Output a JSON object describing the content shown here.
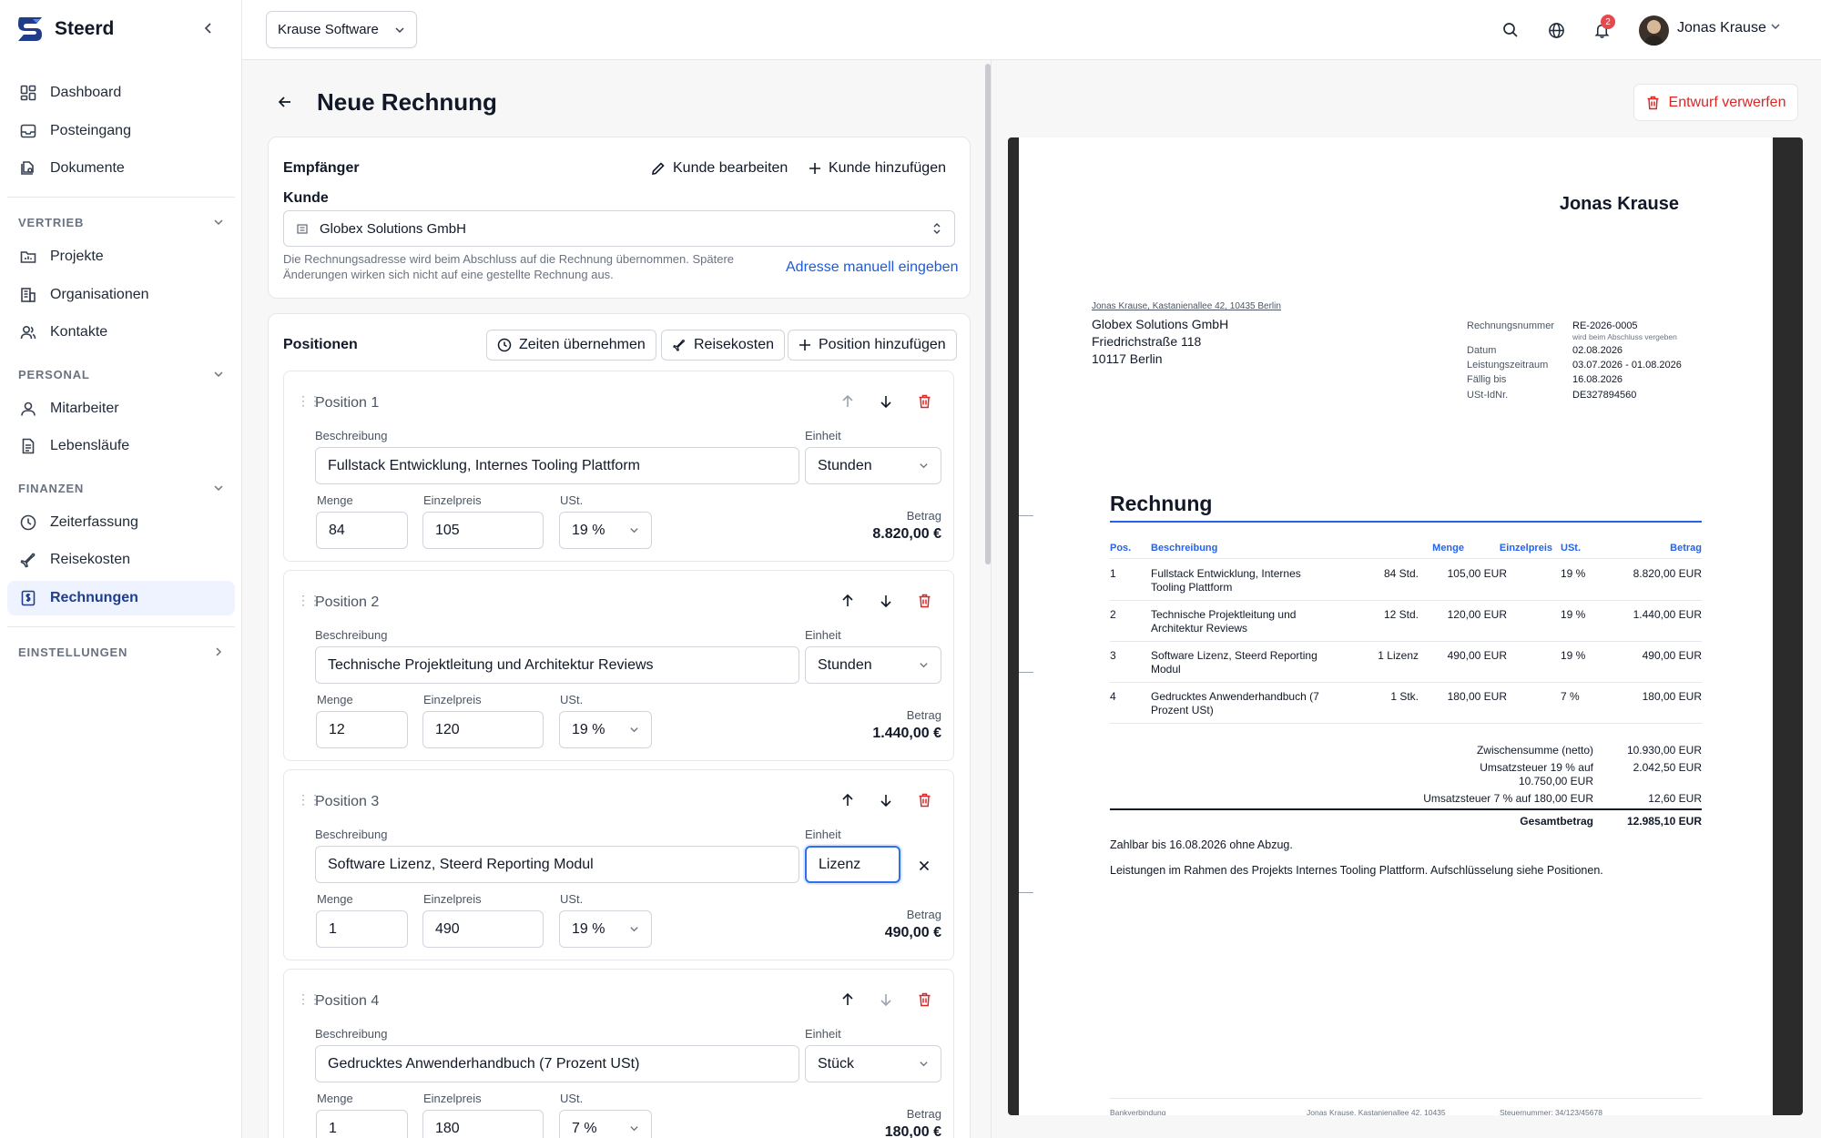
{
  "app": {
    "name": "Steerd"
  },
  "sidebar": {
    "top_items": [
      {
        "label": "Dashboard",
        "icon": "dashboard-icon"
      },
      {
        "label": "Posteingang",
        "icon": "inbox-icon"
      },
      {
        "label": "Dokumente",
        "icon": "documents-icon"
      }
    ],
    "sections": [
      {
        "title": "VERTRIEB",
        "items": [
          {
            "label": "Projekte"
          },
          {
            "label": "Organisationen"
          },
          {
            "label": "Kontakte"
          }
        ]
      },
      {
        "title": "PERSONAL",
        "items": [
          {
            "label": "Mitarbeiter"
          },
          {
            "label": "Lebensläufe"
          }
        ]
      },
      {
        "title": "FINANZEN",
        "items": [
          {
            "label": "Zeiterfassung"
          },
          {
            "label": "Reisekosten"
          },
          {
            "label": "Rechnungen"
          }
        ]
      },
      {
        "title": "EINSTELLUNGEN",
        "items": []
      }
    ],
    "active_item": "Rechnungen"
  },
  "topbar": {
    "org": "Krause Software",
    "notifications_count": "2",
    "user_name": "Jonas Krause"
  },
  "page": {
    "title": "Neue Rechnung",
    "discard_label": "Entwurf verwerfen"
  },
  "recipient": {
    "title": "Empfänger",
    "edit_label": "Kunde bearbeiten",
    "add_label": "Kunde hinzufügen",
    "customer_label": "Kunde",
    "customer_value": "Globex Solutions GmbH",
    "helper_line1": "Die Rechnungsadresse wird beim Abschluss auf die Rechnung übernommen. Spätere",
    "helper_line2": "Änderungen wirken sich nicht auf eine gestellte Rechnung aus.",
    "manual_link": "Adresse manuell eingeben"
  },
  "positions": {
    "title": "Positionen",
    "take_times": "Zeiten übernehmen",
    "travel": "Reisekosten",
    "add_position": "Position hinzufügen",
    "labels": {
      "description": "Beschreibung",
      "unit": "Einheit",
      "quantity": "Menge",
      "unit_price": "Einzelpreis",
      "vat": "USt.",
      "amount": "Betrag"
    },
    "items": [
      {
        "title": "Position 1",
        "description": "Fullstack Entwicklung, Internes Tooling Plattform",
        "unit": "Stunden",
        "quantity": "84",
        "unit_price": "105",
        "vat": "19 %",
        "amount": "8.820,00 €"
      },
      {
        "title": "Position 2",
        "description": "Technische Projektleitung und Architektur Reviews",
        "unit": "Stunden",
        "quantity": "12",
        "unit_price": "120",
        "vat": "19 %",
        "amount": "1.440,00 €"
      },
      {
        "title": "Position 3",
        "description": "Software Lizenz, Steerd Reporting Modul",
        "unit": "Lizenz",
        "quantity": "1",
        "unit_price": "490",
        "vat": "19 %",
        "amount": "490,00 €"
      },
      {
        "title": "Position 4",
        "description": "Gedrucktes Anwenderhandbuch (7 Prozent USt)",
        "unit": "Stück",
        "quantity": "1",
        "unit_price": "180",
        "vat": "7 %",
        "amount": "180,00 €"
      }
    ]
  },
  "preview": {
    "sender_name": "Jonas Krause",
    "sender_line": "Jonas Krause, Kastanienallee 42, 10435 Berlin",
    "recipient_lines": [
      "Globex Solutions GmbH",
      "Friedrichstraße 118",
      "10117 Berlin"
    ],
    "meta": [
      {
        "label": "Rechnungsnummer",
        "value": "RE-2026-0005"
      },
      {
        "label": "Datum",
        "value": "02.08.2026"
      },
      {
        "label": "Leistungszeitraum",
        "value": "03.07.2026 - 01.08.2026"
      },
      {
        "label": "Fällig bis",
        "value": "16.08.2026"
      },
      {
        "label": "USt-IdNr.",
        "value": "DE327894560"
      }
    ],
    "meta_note": "wird beim Abschluss vergeben",
    "heading": "Rechnung",
    "columns": [
      "Pos.",
      "Beschreibung",
      "Menge",
      "Einzelpreis",
      "USt.",
      "Betrag"
    ],
    "rows": [
      {
        "pos": "1",
        "desc1": "Fullstack Entwicklung, Internes",
        "desc2": "Tooling Plattform",
        "qty": "84 Std.",
        "price": "105,00 EUR",
        "vat": "19 %",
        "amount": "8.820,00 EUR"
      },
      {
        "pos": "2",
        "desc1": "Technische Projektleitung und",
        "desc2": "Architektur Reviews",
        "qty": "12 Std.",
        "price": "120,00 EUR",
        "vat": "19 %",
        "amount": "1.440,00 EUR"
      },
      {
        "pos": "3",
        "desc1": "Software Lizenz, Steerd Reporting",
        "desc2": "Modul",
        "qty": "1 Lizenz",
        "price": "490,00 EUR",
        "vat": "19 %",
        "amount": "490,00 EUR"
      },
      {
        "pos": "4",
        "desc1": "Gedrucktes Anwenderhandbuch (7",
        "desc2": "Prozent USt)",
        "qty": "1 Stk.",
        "price": "180,00 EUR",
        "vat": "7 %",
        "amount": "180,00 EUR"
      }
    ],
    "subtotal_label": "Zwischensumme (netto)",
    "subtotal_value": "10.930,00 EUR",
    "vat19_label1": "Umsatzsteuer 19 % auf",
    "vat19_label2": "10.750,00 EUR",
    "vat19_value": "2.042,50 EUR",
    "vat7_label": "Umsatzsteuer 7 % auf 180,00 EUR",
    "vat7_value": "12,60 EUR",
    "total_label": "Gesamtbetrag",
    "total_value": "12.985,10 EUR",
    "payment_text": "Zahlbar bis 16.08.2026 ohne Abzug.",
    "note_text": "Leistungen im Rahmen des Projekts Internes Tooling Plattform. Aufschlüsselung siehe Positionen.",
    "footer_left": "Bankverbindung",
    "footer_mid": "Jonas Krause, Kastanienallee 42, 10435",
    "footer_right": "Steuernummer: 34/123/45678"
  }
}
